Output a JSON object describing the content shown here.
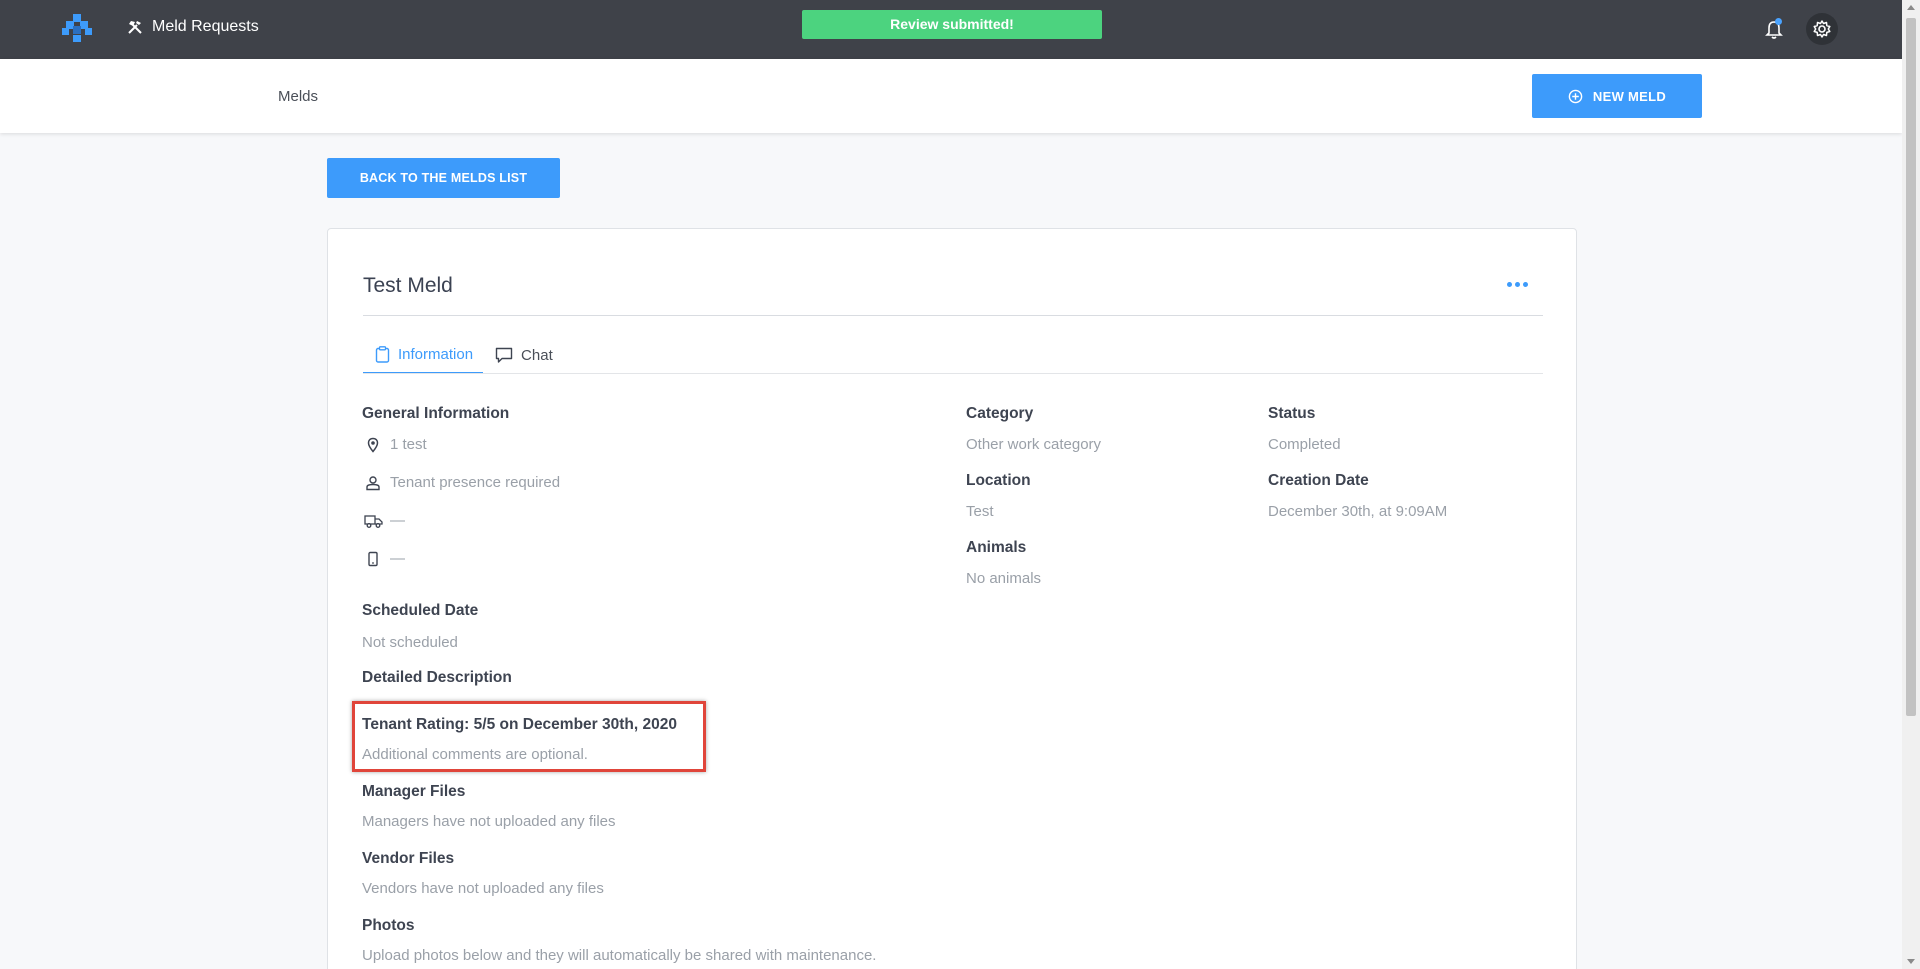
{
  "topbar": {
    "app_title": "Meld Requests",
    "toast": "Review submitted!"
  },
  "subheader": {
    "breadcrumb": "Melds",
    "new_meld_label": "NEW MELD"
  },
  "back_label": "BACK TO THE MELDS LIST",
  "meld": {
    "title": "Test Meld",
    "tabs": [
      {
        "label": "Information",
        "icon": "clipboard-icon",
        "active": true
      },
      {
        "label": "Chat",
        "icon": "chat-icon",
        "active": false
      }
    ],
    "general": {
      "heading": "General Information",
      "address": "1 test",
      "tenant_presence": "Tenant presence required",
      "vehicle": "—",
      "phone": "—"
    },
    "scheduled": {
      "heading": "Scheduled Date",
      "value": "Not scheduled"
    },
    "description": {
      "heading": "Detailed Description"
    },
    "rating": {
      "heading": "Tenant Rating: 5/5 on December 30th, 2020",
      "comment": "Additional comments are optional."
    },
    "manager_files": {
      "heading": "Manager Files",
      "value": "Managers have not uploaded any files"
    },
    "vendor_files": {
      "heading": "Vendor Files",
      "value": "Vendors have not uploaded any files"
    },
    "photos": {
      "heading": "Photos",
      "value": "Upload photos below and they will automatically be shared with maintenance."
    },
    "category": {
      "heading": "Category",
      "value": "Other work category"
    },
    "location": {
      "heading": "Location",
      "value": "Test"
    },
    "animals": {
      "heading": "Animals",
      "value": "No animals"
    },
    "status": {
      "heading": "Status",
      "value": "Completed"
    },
    "creation_date": {
      "heading": "Creation Date",
      "value": "December 30th, at 9:09AM"
    }
  },
  "colors": {
    "topbar": "#3f4249",
    "accent": "#3d9bfb",
    "toast": "#4cd37f",
    "highlight": "#e0453a"
  }
}
